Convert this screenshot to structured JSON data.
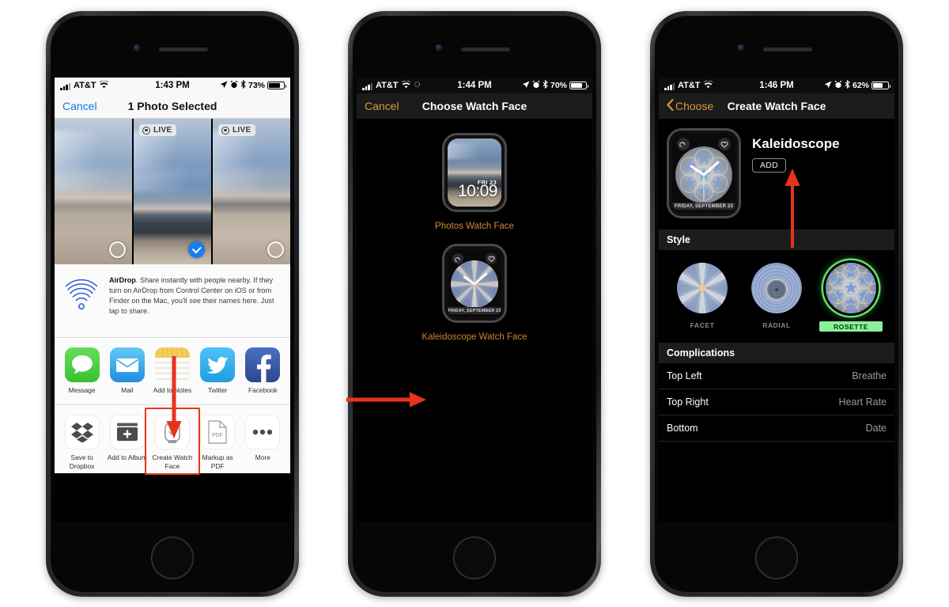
{
  "phone1": {
    "status": {
      "signal_carrier": "AT&T",
      "time": "1:43 PM",
      "battery_pct": "73%"
    },
    "nav": {
      "left": "Cancel",
      "title": "1 Photo Selected"
    },
    "photos": [
      {
        "live": false,
        "selected": false,
        "badge": ""
      },
      {
        "live": true,
        "selected": true,
        "badge": "LIVE"
      },
      {
        "live": true,
        "selected": false,
        "badge": "LIVE"
      }
    ],
    "airdrop": {
      "title": "AirDrop",
      "text": ". Share instantly with people nearby. If they turn on AirDrop from Control Center on iOS or from Finder on the Mac, you'll see their names here. Just tap to share."
    },
    "apps": [
      {
        "label": "Message",
        "icon": "messages-icon"
      },
      {
        "label": "Mail",
        "icon": "mail-icon"
      },
      {
        "label": "Add to Notes",
        "icon": "notes-icon"
      },
      {
        "label": "Twitter",
        "icon": "twitter-icon"
      },
      {
        "label": "Facebook",
        "icon": "facebook-icon"
      }
    ],
    "actions": [
      {
        "label": "Save to Dropbox",
        "icon": "dropbox-icon",
        "highlighted": false
      },
      {
        "label": "Add to Album",
        "icon": "add-to-album-icon",
        "highlighted": false
      },
      {
        "label": "Create Watch Face",
        "icon": "watch-icon",
        "highlighted": true
      },
      {
        "label": "Markup as PDF",
        "icon": "pdf-icon",
        "highlighted": false
      },
      {
        "label": "More",
        "icon": "more-icon",
        "highlighted": false
      }
    ],
    "pdf_glyph": "PDF"
  },
  "phone2": {
    "status": {
      "signal_carrier": "AT&T",
      "time": "1:44 PM",
      "battery_pct": "70%"
    },
    "nav": {
      "left": "Cancel",
      "title": "Choose Watch Face"
    },
    "faces": [
      {
        "caption": "Photos Watch Face",
        "type": "photos",
        "date": "FRI 23",
        "time": "10:09"
      },
      {
        "caption": "Kaleidoscope Watch Face",
        "type": "kaleidoscope",
        "date": "FRIDAY, SEPTEMBER 23"
      }
    ]
  },
  "phone3": {
    "status": {
      "signal_carrier": "AT&T",
      "time": "1:46 PM",
      "battery_pct": "62%"
    },
    "nav": {
      "back": "Choose",
      "title": "Create Watch Face"
    },
    "preview": {
      "title": "Kaleidoscope",
      "add_label": "ADD",
      "date": "FRIDAY, SEPTEMBER 23"
    },
    "sections": {
      "style": "Style",
      "complications": "Complications"
    },
    "styles": [
      {
        "label": "FACET",
        "selected": false
      },
      {
        "label": "RADIAL",
        "selected": false
      },
      {
        "label": "ROSETTE",
        "selected": true
      }
    ],
    "complications": [
      {
        "key": "Top Left",
        "value": "Breathe"
      },
      {
        "key": "Top Right",
        "value": "Heart Rate"
      },
      {
        "key": "Bottom",
        "value": "Date"
      }
    ]
  },
  "colors": {
    "arrow_red": "#e8331c",
    "amber": "#c8852f",
    "ios_blue": "#1a7ef0",
    "highlight_green": "#5ee36a"
  }
}
